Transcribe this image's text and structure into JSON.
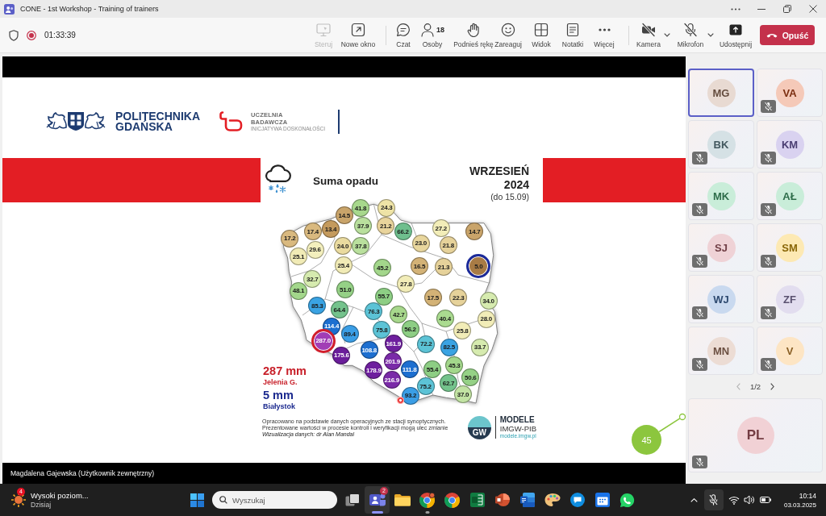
{
  "window": {
    "title": "CONE - 1st Workshop - Training of trainers"
  },
  "toolbar": {
    "recording": true,
    "timer": "01:33:39",
    "window_actions": [
      {
        "label": "Steruj",
        "disabled": true
      },
      {
        "label": "Nowe okno",
        "disabled": false
      }
    ],
    "meeting_actions": [
      {
        "label": "Czat"
      },
      {
        "label": "Osoby",
        "count": "18"
      },
      {
        "label": "Podnieś rękę"
      },
      {
        "label": "Zareaguj"
      },
      {
        "label": "Widok"
      },
      {
        "label": "Notatki"
      },
      {
        "label": "Więcej"
      }
    ],
    "devices": [
      {
        "label": "Kamera",
        "on": false
      },
      {
        "label": "Mikrofon",
        "on": false
      }
    ],
    "share": {
      "label": "Udostępnij"
    },
    "leave": {
      "label": "Opuść"
    }
  },
  "screen_share": {
    "slide": {
      "university": {
        "lines": [
          "POLITECHNIKA",
          "GDAŃSKA"
        ]
      },
      "research_badge": {
        "lines": [
          "UCZELNIA",
          "BADAWCZA"
        ],
        "tagline": "INICJATYWA DOSKONAŁOŚCI"
      },
      "title": "Suma opadu",
      "period": {
        "lines": [
          "WRZESIEŃ",
          "2024"
        ],
        "note": "(do 15.09)"
      },
      "stations": [
        {
          "kind": "value",
          "value": "14.5",
          "color": "#c9a46a"
        },
        {
          "kind": "value",
          "value": "41.8",
          "color": "#a7d88c"
        },
        {
          "kind": "value",
          "value": "24.3",
          "color": "#eee3a6"
        },
        {
          "kind": "value",
          "value": "17.4",
          "color": "#d9b97f"
        },
        {
          "kind": "value",
          "value": "13.4",
          "color": "#c49a5d"
        },
        {
          "kind": "value",
          "value": "37.9",
          "color": "#b9e09d"
        },
        {
          "kind": "value",
          "value": "21.2",
          "color": "#e9d49c"
        },
        {
          "kind": "value",
          "value": "66.2",
          "color": "#6fbf8e"
        },
        {
          "kind": "value",
          "value": "27.2",
          "color": "#f2edb8"
        },
        {
          "kind": "value",
          "value": "17.2",
          "color": "#d9b97f"
        },
        {
          "kind": "value",
          "value": "14.7",
          "color": "#c9a46a"
        },
        {
          "kind": "value",
          "value": "29.6",
          "color": "#f3efbd"
        },
        {
          "kind": "value",
          "value": "24.0",
          "color": "#eadb9f"
        },
        {
          "kind": "value",
          "value": "37.8",
          "color": "#b9e09d"
        },
        {
          "kind": "value",
          "value": "23.0",
          "color": "#e8d69d"
        },
        {
          "kind": "value",
          "value": "21.8",
          "color": "#e6d29a"
        },
        {
          "kind": "value",
          "value": "25.1",
          "color": "#f1ebb6"
        },
        {
          "kind": "value",
          "value": "25.4",
          "color": "#f1ebb6"
        },
        {
          "kind": "value",
          "value": "45.2",
          "color": "#a3d78b"
        },
        {
          "kind": "value",
          "value": "16.5",
          "color": "#d3b276"
        },
        {
          "kind": "value",
          "value": "21.3",
          "color": "#e6d29a"
        },
        {
          "kind": "min",
          "value": "5.0",
          "color": "#a87b45"
        },
        {
          "kind": "value",
          "value": "32.7",
          "color": "#d6ebaf"
        },
        {
          "kind": "value",
          "value": "48.1",
          "color": "#a3d78b"
        },
        {
          "kind": "value",
          "value": "51.0",
          "color": "#95d186"
        },
        {
          "kind": "value",
          "value": "27.8",
          "color": "#f2edb8"
        },
        {
          "kind": "value",
          "value": "55.7",
          "color": "#8dce84"
        },
        {
          "kind": "value",
          "value": "17.5",
          "color": "#d3b276"
        },
        {
          "kind": "value",
          "value": "22.3",
          "color": "#e6d29a"
        },
        {
          "kind": "value",
          "value": "85.3",
          "color": "#3aa3e3"
        },
        {
          "kind": "value",
          "value": "64.4",
          "color": "#74c38c"
        },
        {
          "kind": "value",
          "value": "34.0",
          "color": "#d6ebaf"
        },
        {
          "kind": "value",
          "value": "76.3",
          "color": "#5cc3d6"
        },
        {
          "kind": "value",
          "value": "42.7",
          "color": "#a7d88c"
        },
        {
          "kind": "value",
          "value": "40.4",
          "color": "#aadb90"
        },
        {
          "kind": "value",
          "value": "28.0",
          "color": "#f2edb8"
        },
        {
          "kind": "value",
          "value": "114.4",
          "color": "#1d6fd0"
        },
        {
          "kind": "value",
          "value": "89.4",
          "color": "#3a9ee6"
        },
        {
          "kind": "value",
          "value": "75.8",
          "color": "#5cc3d6"
        },
        {
          "kind": "value",
          "value": "56.2",
          "color": "#8dce84"
        },
        {
          "kind": "value",
          "value": "25.8",
          "color": "#f2edb8"
        },
        {
          "kind": "max",
          "value": "287.0",
          "color": "#a13db5"
        },
        {
          "kind": "value",
          "value": "161.9",
          "color": "#6e1f9e"
        },
        {
          "kind": "value",
          "value": "72.2",
          "color": "#5cc3d6"
        },
        {
          "kind": "value",
          "value": "82.5",
          "color": "#3aa3e3"
        },
        {
          "kind": "value",
          "value": "33.7",
          "color": "#d6ebaf"
        },
        {
          "kind": "value",
          "value": "175.6",
          "color": "#6a1d9a"
        },
        {
          "kind": "value",
          "value": "108.8",
          "color": "#1d6fd0"
        },
        {
          "kind": "value",
          "value": "178.9",
          "color": "#6e1f9e"
        },
        {
          "kind": "value",
          "value": "201.9",
          "color": "#7a2aa8"
        },
        {
          "kind": "value",
          "value": "111.8",
          "color": "#1d6fd0"
        },
        {
          "kind": "value",
          "value": "55.4",
          "color": "#8dce84"
        },
        {
          "kind": "value",
          "value": "45.3",
          "color": "#a3d78b"
        },
        {
          "kind": "value",
          "value": "216.9",
          "color": "#7a2aa8"
        },
        {
          "kind": "value",
          "value": "75.2",
          "color": "#5cc3d6"
        },
        {
          "kind": "value",
          "value": "62.7",
          "color": "#74c38c"
        },
        {
          "kind": "value",
          "value": "50.6",
          "color": "#95d186"
        },
        {
          "kind": "value",
          "value": "93.2",
          "color": "#3a9ee6"
        },
        {
          "kind": "value",
          "value": "37.0",
          "color": "#c2e3a3"
        }
      ],
      "legend": [
        {
          "value": "287 mm",
          "place": "Jelenia G.",
          "color": "#c8202a"
        },
        {
          "value": "5 mm",
          "place": "Białystok",
          "color": "#1c2a8f"
        }
      ],
      "notes": [
        "Opracowano na podstawie danych operacyjnych ze stacji synoptycznych.",
        "Prezentowane wartości w procesie kontroli i weryfikacji mogą ulec zmianie"
      ],
      "credit": "Wizualizacja danych: dr Alan Mandal",
      "source": {
        "mark": "GW",
        "name": "MODELE",
        "org": "IMGW-PIB",
        "url": "modele.imgw.pl"
      }
    },
    "pointer": {
      "value": "45"
    },
    "presenter": "Magdalena Gajewska (Użytkownik zewnętrzny)"
  },
  "participants": [
    {
      "initials": "MG",
      "color": "#e8dad2",
      "muted": false,
      "highlighted": true
    },
    {
      "initials": "VA",
      "color": "#f5c9b8",
      "muted": true,
      "highlighted": false
    },
    {
      "initials": "BK",
      "color": "#d5e1e5",
      "muted": true,
      "highlighted": false
    },
    {
      "initials": "KM",
      "color": "#d9d2f0",
      "muted": true,
      "highlighted": false
    },
    {
      "initials": "MK",
      "color": "#c9edd9",
      "muted": true,
      "highlighted": false
    },
    {
      "initials": "AŁ",
      "color": "#c9edd9",
      "muted": true,
      "highlighted": false
    },
    {
      "initials": "SJ",
      "color": "#efd2d6",
      "muted": true,
      "highlighted": false
    },
    {
      "initials": "SM",
      "color": "#fde9b3",
      "muted": true,
      "highlighted": false
    },
    {
      "initials": "WJ",
      "color": "#c9d9ef",
      "muted": true,
      "highlighted": false
    },
    {
      "initials": "ZF",
      "color": "#e2ddef",
      "muted": true,
      "highlighted": false
    },
    {
      "initials": "MN",
      "color": "#ecdcd4",
      "muted": true,
      "highlighted": false
    },
    {
      "initials": "V",
      "color": "#fde5c4",
      "muted": true,
      "highlighted": false
    }
  ],
  "pager": "1/2",
  "featured_participant": {
    "initials": "PL",
    "color": "#f1d1d5",
    "muted": true
  },
  "taskbar": {
    "widget": {
      "badge": "4",
      "title": "Wysoki poziom...",
      "subtitle": "Dzisiaj"
    },
    "search": {
      "placeholder": "Wyszukaj"
    },
    "apps": [
      {
        "running": false,
        "active": false
      },
      {
        "running": true,
        "active": true,
        "badge": "2"
      },
      {
        "running": false,
        "active": false
      },
      {
        "running": true,
        "active": false
      },
      {
        "running": false,
        "active": false
      },
      {
        "running": false,
        "active": false
      },
      {
        "running": false,
        "active": false
      },
      {
        "running": false,
        "active": false
      },
      {
        "running": false,
        "active": false
      },
      {
        "running": false,
        "active": false
      },
      {
        "running": false,
        "active": false
      },
      {
        "running": false,
        "active": false
      }
    ],
    "tray": {
      "mic_muted": true
    },
    "clock": {
      "time": "10:14",
      "date": "03.03.2025"
    }
  }
}
